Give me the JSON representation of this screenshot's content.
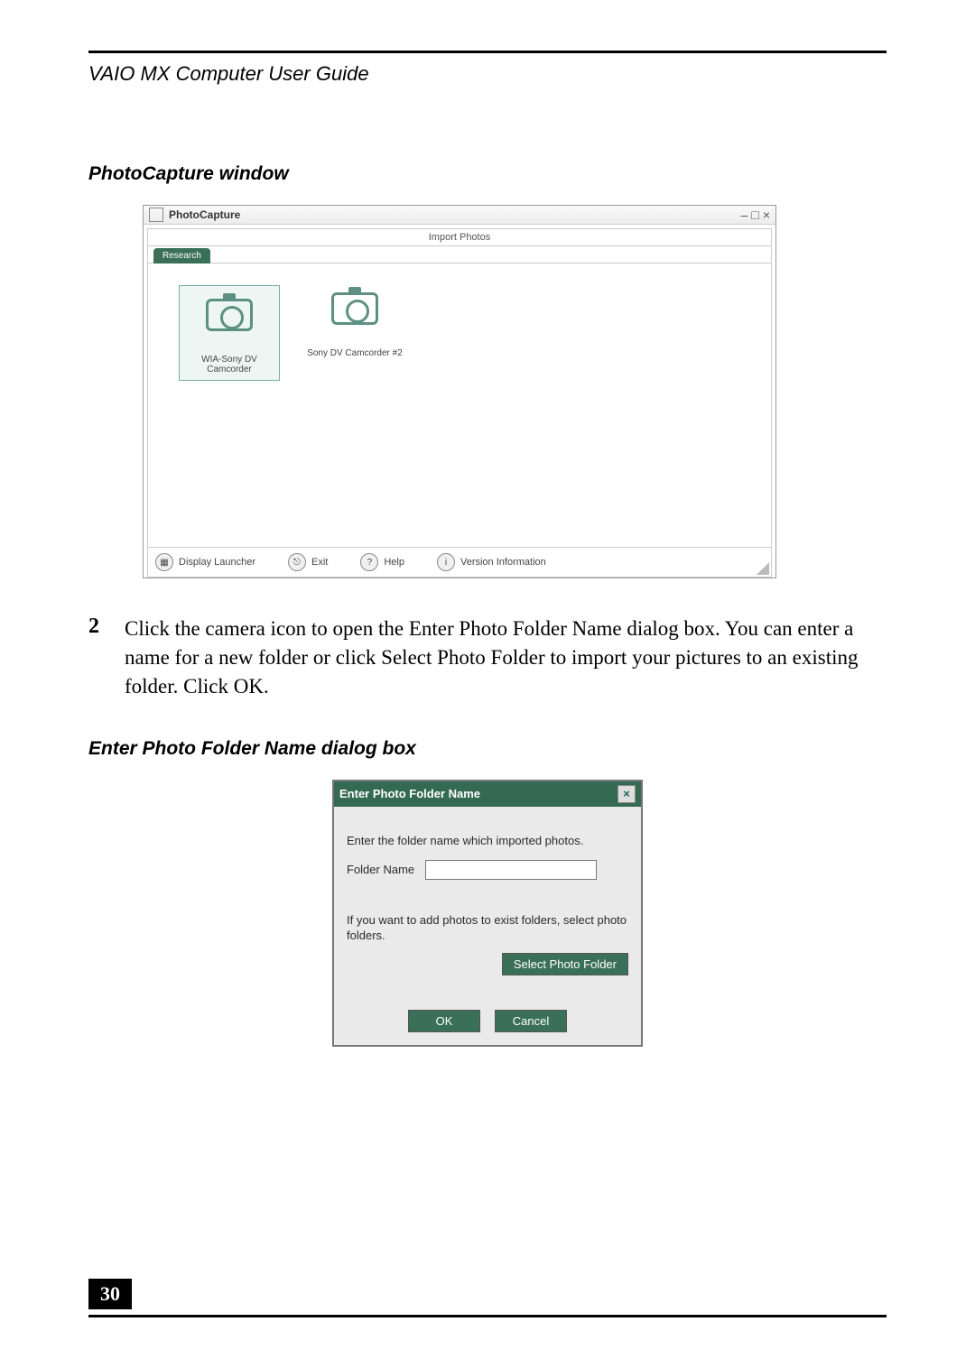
{
  "running_head": "VAIO MX Computer User Guide",
  "section_title_1": "PhotoCapture window",
  "fig1": {
    "window_title": "PhotoCapture",
    "win_buttons": {
      "min": "–",
      "max": "□",
      "close": "×"
    },
    "header_label": "Import Photos",
    "tab_label": "Research",
    "devices": [
      {
        "label": "WIA-Sony DV Camcorder"
      },
      {
        "label": "Sony DV Camcorder #2"
      }
    ],
    "footer": {
      "display_launcher": "Display Launcher",
      "exit": "Exit",
      "help": "Help",
      "version": "Version Information"
    }
  },
  "step": {
    "number": "2",
    "text": "Click the camera icon to open the Enter Photo Folder Name dialog box. You can enter a name for a new folder or click Select Photo Folder to import your pictures to an existing folder. Click OK."
  },
  "section_title_2": "Enter Photo Folder Name dialog box",
  "fig2": {
    "title": "Enter Photo Folder Name",
    "close": "×",
    "prompt": "Enter the folder name which imported photos.",
    "folder_label": "Folder Name",
    "folder_value": "",
    "exist_text": "If you want to add photos to exist folders, select photo folders.",
    "select_btn": "Select Photo Folder",
    "ok": "OK",
    "cancel": "Cancel"
  },
  "page_number": "30"
}
